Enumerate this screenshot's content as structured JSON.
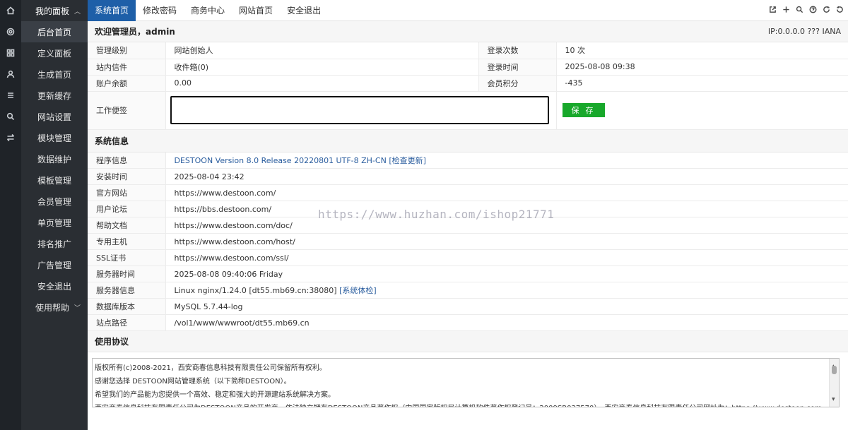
{
  "rail": {
    "icons": [
      "home-icon",
      "target-icon",
      "grid-icon",
      "user-icon",
      "list-icon",
      "search-icon",
      "swap-icon"
    ]
  },
  "sidebar": {
    "head": "我的面板",
    "items": [
      "后台首页",
      "定义面板",
      "生成首页",
      "更新缓存",
      "网站设置",
      "模块管理",
      "数据维护",
      "模板管理",
      "会员管理",
      "单页管理",
      "排名推广",
      "广告管理",
      "安全退出"
    ],
    "help": "使用帮助"
  },
  "topnav": {
    "tabs": [
      "系统首页",
      "修改密码",
      "商务中心",
      "网站首页",
      "安全退出"
    ],
    "icons": [
      "external-link-icon",
      "plus-icon",
      "search-icon",
      "help-icon",
      "refresh-icon",
      "reload-icon"
    ]
  },
  "welcome": {
    "title": "欢迎管理员，admin",
    "ip": "IP:0.0.0.0 ??? IANA"
  },
  "account": {
    "rows": [
      {
        "label": "管理级别",
        "value": "网站创始人",
        "label2": "登录次数",
        "value2": "10 次"
      },
      {
        "label": "站内信件",
        "value": "收件箱(0)",
        "label2": "登录时间",
        "value2": "2025-08-08 09:38"
      },
      {
        "label": "账户余额",
        "value": "0.00",
        "label2": "会员积分",
        "value2": "-435"
      }
    ],
    "memo_label": "工作便签",
    "save_label": "保 存"
  },
  "sysinfo": {
    "title": "系统信息",
    "program_label": "程序信息",
    "program_value": "DESTOON Version 8.0 Release 20220801 UTF-8 ZH-CN",
    "program_link": "[检查更新]",
    "rows": [
      {
        "label": "安装时间",
        "value": "2025-08-04 23:42"
      },
      {
        "label": "官方网站",
        "value": "https://www.destoon.com/"
      },
      {
        "label": "用户论坛",
        "value": "https://bbs.destoon.com/"
      },
      {
        "label": "帮助文档",
        "value": "https://www.destoon.com/doc/"
      },
      {
        "label": "专用主机",
        "value": "https://www.destoon.com/host/"
      },
      {
        "label": "SSL证书",
        "value": "https://www.destoon.com/ssl/"
      },
      {
        "label": "服务器时间",
        "value": "2025-08-08 09:40:06 Friday"
      }
    ],
    "server_label": "服务器信息",
    "server_value": "Linux nginx/1.24.0 [dt55.mb69.cn:38080]",
    "server_link": "[系统体检]",
    "rows2": [
      {
        "label": "数据库版本",
        "value": "MySQL 5.7.44-log"
      },
      {
        "label": "站点路径",
        "value": "/vol1/www/wwwroot/dt55.mb69.cn"
      }
    ]
  },
  "agreement": {
    "title": "使用协议",
    "lines": [
      "版权所有(c)2008-2021，西安商春信息科技有限责任公司保留所有权利。",
      "感谢您选择 DESTOON网站管理系统（以下简称DESTOON）。",
      "希望我们的产品能为您提供一个高效、稳定和强大的开源建站系统解决方案。",
      "西安商春信息科技有限责任公司为DESTOON产品的开发商，依法独立拥有DESTOON产品著作权（中国国家版权局计算机软件著作权登记号：2009SR037570）。西安商春信息科技有限责任公司网址为：https://www.destoon.com"
    ]
  },
  "watermark": "https://www.huzhan.com/ishop21771"
}
